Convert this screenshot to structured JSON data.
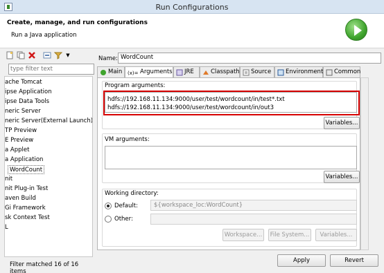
{
  "window": {
    "title": "Run Configurations"
  },
  "header": {
    "title": "Create, manage, and run configurations",
    "subtitle": "Run a Java application"
  },
  "left": {
    "toolbar_icons": [
      "new-config-icon",
      "duplicate-icon",
      "delete-icon",
      "collapse-all-icon",
      "filter-icon",
      "dropdown-arrow-icon"
    ],
    "filter_placeholder": "type filter text",
    "tree": [
      "ache Tomcat",
      "ipse Application",
      "ipse Data Tools",
      "neric Server",
      "neric Server(External Launch)",
      "TP Preview",
      "E Preview",
      "a Applet",
      "a Application",
      "WordCount",
      "nit",
      "nit Plug-in Test",
      "aven Build",
      "Gi Framework",
      "sk Context Test",
      "L"
    ],
    "selected_index": 9,
    "filter_status": "Filter matched 16 of 16 items"
  },
  "right": {
    "name_label": "Name:",
    "name_value": "WordCount",
    "tabs": [
      "Main",
      "Arguments",
      "JRE",
      "Classpath",
      "Source",
      "Environment",
      "Common"
    ],
    "active_tab": "Arguments",
    "program_args_label": "Program arguments:",
    "program_args_value": "hdfs://192.168.11.134:9000/user/test/wordcount/in/test*.txt\nhdfs://192.168.11.134:9000/user/test/wordcount/in/out3",
    "variables_label": "Variables...",
    "vm_args_label": "VM arguments:",
    "vm_args_value": "",
    "working_dir_label": "Working directory:",
    "default_label": "Default:",
    "default_value": "${workspace_loc:WordCount}",
    "other_label": "Other:",
    "other_value": "",
    "workspace_btn": "Workspace...",
    "filesystem_btn": "File System...",
    "apply_label": "Apply",
    "revert_label": "Revert"
  },
  "colors": {
    "highlight": "#d60000",
    "accent": "#3fa42d"
  }
}
